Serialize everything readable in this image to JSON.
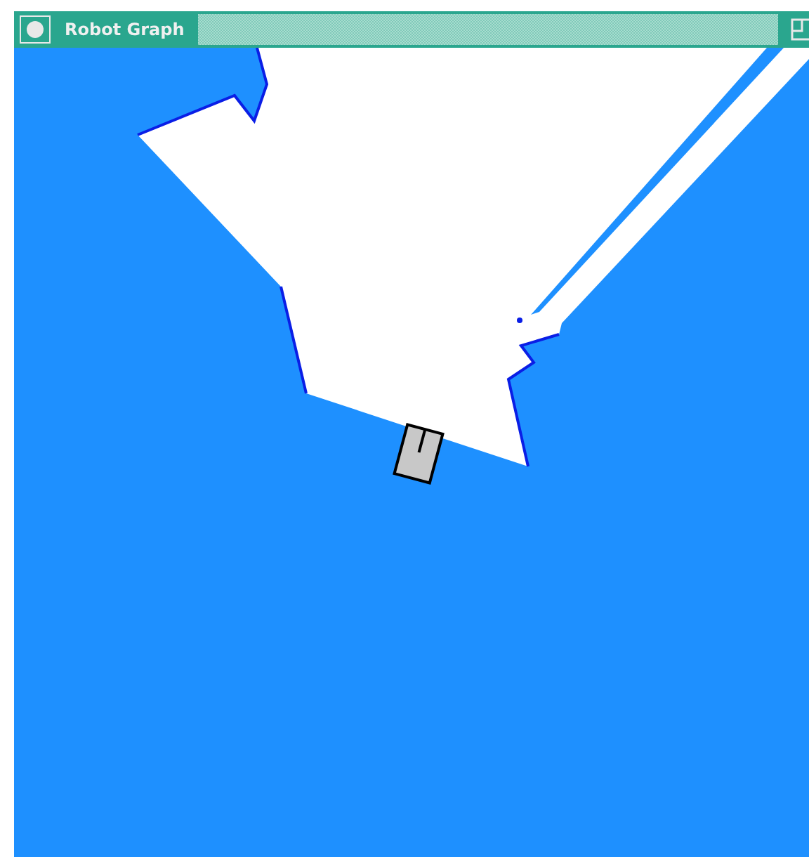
{
  "window": {
    "title": "Robot Graph"
  }
}
